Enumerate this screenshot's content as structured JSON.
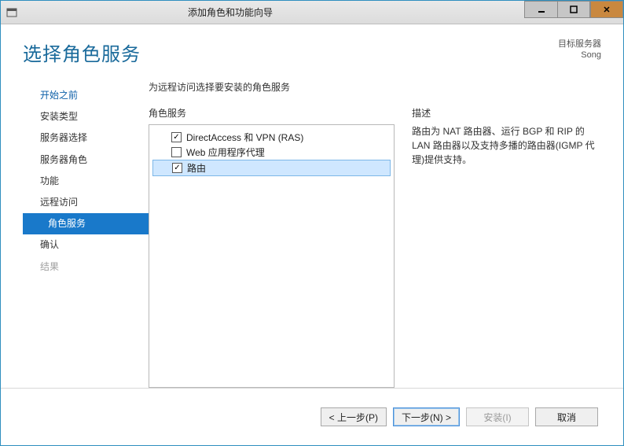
{
  "window": {
    "title": "添加角色和功能向导"
  },
  "header": {
    "page_title": "选择角色服务",
    "target_label": "目标服务器",
    "target_value": "Song"
  },
  "sidebar": {
    "items": [
      {
        "label": "开始之前",
        "kind": "link"
      },
      {
        "label": "安装类型",
        "kind": "normal"
      },
      {
        "label": "服务器选择",
        "kind": "normal"
      },
      {
        "label": "服务器角色",
        "kind": "normal"
      },
      {
        "label": "功能",
        "kind": "normal"
      },
      {
        "label": "远程访问",
        "kind": "normal"
      },
      {
        "label": "角色服务",
        "kind": "selected"
      },
      {
        "label": "确认",
        "kind": "normal"
      },
      {
        "label": "结果",
        "kind": "disabled"
      }
    ]
  },
  "main": {
    "instruction": "为远程访问选择要安装的角色服务",
    "roles_label": "角色服务",
    "desc_label": "描述",
    "roles": [
      {
        "label": "DirectAccess 和 VPN (RAS)",
        "checked": true,
        "selected": false
      },
      {
        "label": "Web 应用程序代理",
        "checked": false,
        "selected": false
      },
      {
        "label": "路由",
        "checked": true,
        "selected": true
      }
    ],
    "description": "路由为 NAT 路由器、运行 BGP 和 RIP 的 LAN 路由器以及支持多播的路由器(IGMP 代理)提供支持。"
  },
  "buttons": {
    "prev": "< 上一步(P)",
    "next": "下一步(N) >",
    "install": "安装(I)",
    "cancel": "取消"
  }
}
